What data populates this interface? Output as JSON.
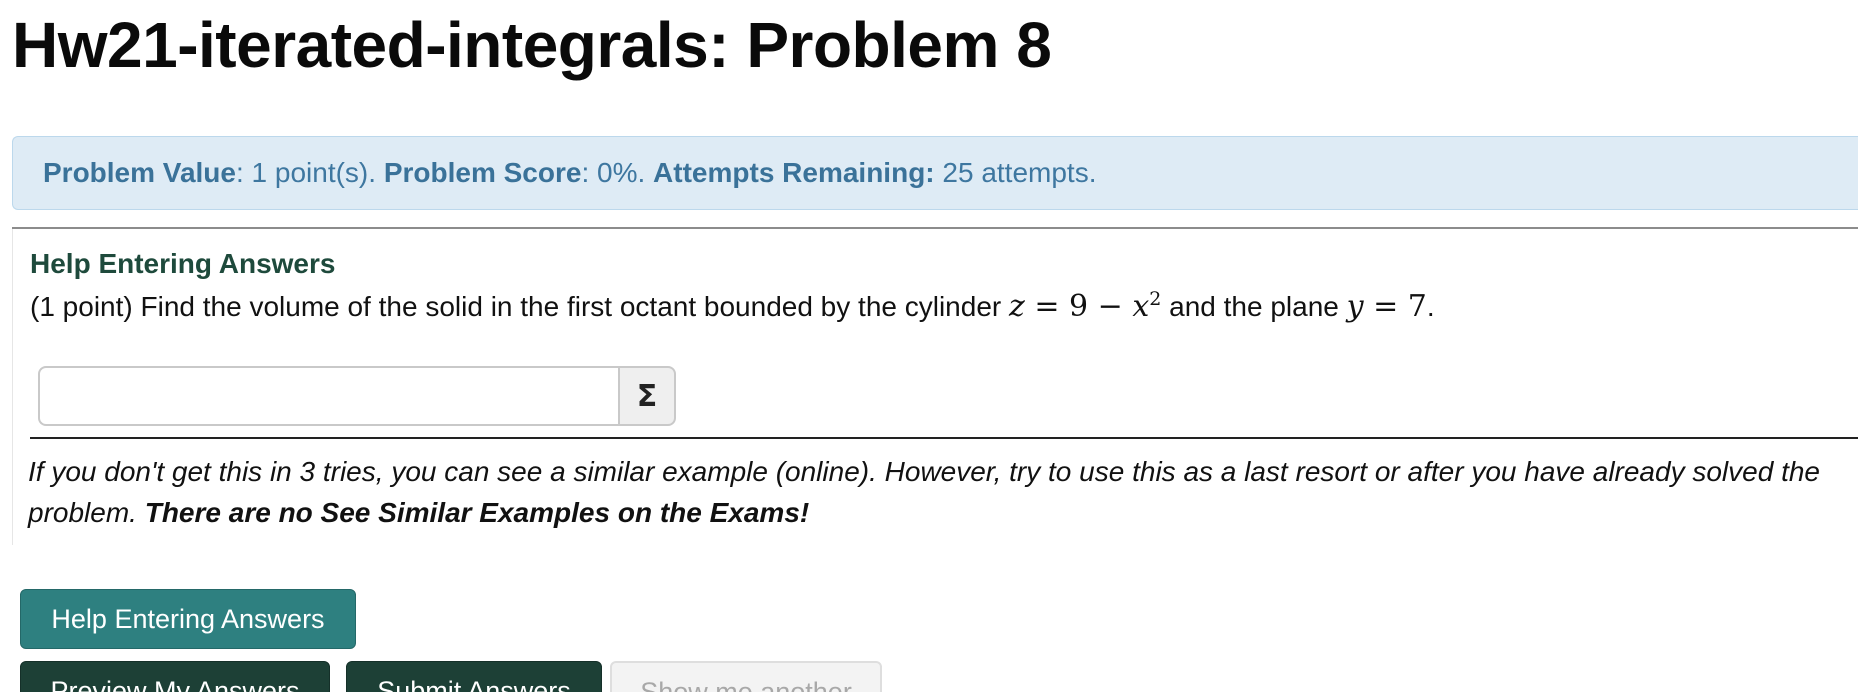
{
  "header": {
    "title": "Hw21-iterated-integrals: Problem 8"
  },
  "score_bar": {
    "value_label": "Problem Value",
    "value_text": ": 1 point(s). ",
    "score_label": "Problem Score",
    "score_text": ": 0%. ",
    "attempts_label": "Attempts Remaining:",
    "attempts_text": " 25 attempts."
  },
  "problem": {
    "help_link": "Help Entering Answers",
    "text_before": "(1 point) Find the volume of the solid in the first octant bounded by the cylinder ",
    "eq1_var": "z",
    "eq1_rhs": " = 9 − ",
    "eq1_x": "x",
    "eq1_exp": "2",
    "text_middle": " and the plane ",
    "eq2_var": "y",
    "eq2_rhs": " = 7",
    "text_end": ".",
    "answer_value": "",
    "sigma_symbol": "Σ"
  },
  "hint": {
    "text": "If you don't get this in 3 tries, you can see a similar example (online). However, try to use this as a last resort or after you have already solved the problem. ",
    "bold_text": "There are no See Similar Examples on the Exams!"
  },
  "buttons": {
    "help": "Help Entering Answers",
    "preview": "Preview My Answers",
    "submit": "Submit Answers",
    "another": "Show me another"
  },
  "colors": {
    "score_bar_bg": "#deebf5",
    "score_bar_text": "#3e77a0",
    "help_button": "#2e8080",
    "primary_button": "#1d4036",
    "help_link": "#1e4a3c"
  }
}
